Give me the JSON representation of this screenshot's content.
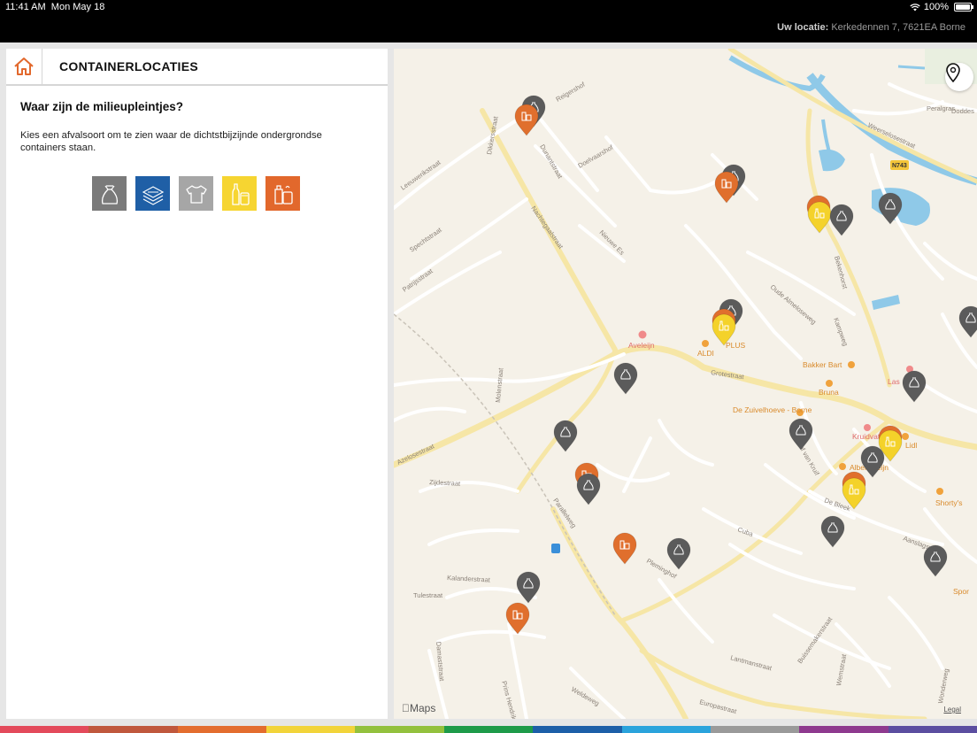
{
  "status": {
    "time": "11:41 AM",
    "date": "Mon May 18",
    "battery": "100%"
  },
  "location": {
    "label": "Uw locatie:",
    "address": "Kerkedennen 7, 7621EA Borne"
  },
  "panel": {
    "title": "CONTAINERLOCATIES",
    "question": "Waar zijn de milieupleintjes?",
    "description": "Kies een afvalsoort om te zien waar de dichtstbijzijnde ondergrondse containers staan."
  },
  "waste_types": [
    {
      "icon": "waste-bag-icon",
      "color": "#7a7a7a"
    },
    {
      "icon": "paper-icon",
      "color": "#1f5fa6"
    },
    {
      "icon": "textile-shirt-icon",
      "color": "#a6a6a6"
    },
    {
      "icon": "glass-bottle-icon",
      "color": "#f6d531"
    },
    {
      "icon": "pmd-packaging-icon",
      "color": "#e2682c"
    }
  ],
  "map": {
    "streets": [
      "Dikkersstraat",
      "Reigershof",
      "Dunantstraat",
      "Doelvaarshof",
      "Nachtegaalstraat",
      "Nieuwe Es",
      "Leeuwerikstraat",
      "Spechtstraat",
      "Patrijsstraat",
      "Weerselosestraat",
      "Bekenhorst",
      "Oude Almeloseweg",
      "Kampweg",
      "Grotestraat",
      "Molenstraat",
      "Azelosestraat",
      "Zijdestraat",
      "Parallelweg",
      "Tulestraat",
      "Kalanderstraat",
      "Damaststraat",
      "Prins Hendrik",
      "Weldeweg",
      "Europastraat",
      "Pleminghof",
      "Hof van Kruif",
      "De Bleek",
      "Cuba",
      "Aanslagsweg",
      "Lantmanstraat",
      "Buissemakerstraat",
      "Wemstraat",
      "Wonderweg",
      "Peralgras",
      "Doddes"
    ],
    "road_shield": "N743",
    "pois": [
      "Aveleijn",
      "PLUS",
      "ALDI",
      "Bakker Bart",
      "Bruna",
      "De Zuivelhoeve - Borne",
      "Kruidvat",
      "Lidl",
      "Albert Heijn",
      "Shorty's",
      "Las",
      "Spor"
    ],
    "attribution": "Maps",
    "legal": "Legal"
  },
  "colors": {
    "grey_container": "#5b5b5b",
    "orange_container": "#e06f2d",
    "yellow_container": "#f4d22a",
    "accent": "#e2682c"
  },
  "bottom_bar_colors": [
    "#e34a5b",
    "#c0583d",
    "#e36d2f",
    "#f2d43a",
    "#93c13e",
    "#1e9b4a",
    "#1d5fa8",
    "#2aa3dc",
    "#9a9a9a",
    "#8e3a8f",
    "#5b4ea0"
  ]
}
